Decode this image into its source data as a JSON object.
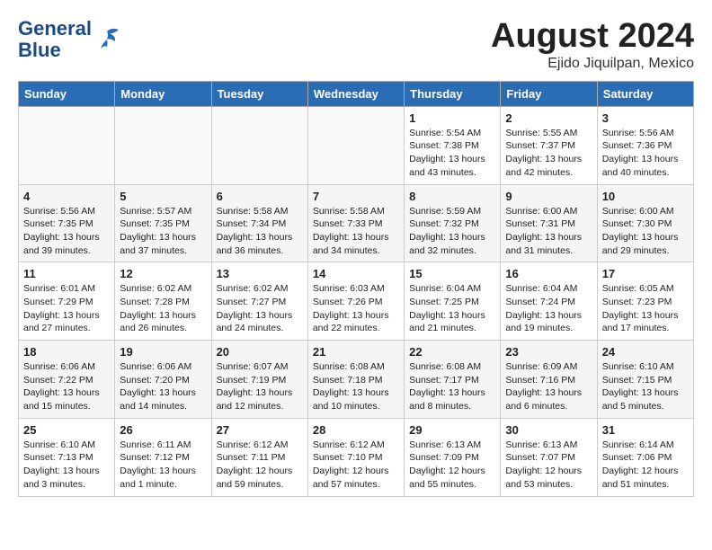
{
  "header": {
    "logo_line1": "General",
    "logo_line2": "Blue",
    "month_year": "August 2024",
    "location": "Ejido Jiquilpan, Mexico"
  },
  "weekdays": [
    "Sunday",
    "Monday",
    "Tuesday",
    "Wednesday",
    "Thursday",
    "Friday",
    "Saturday"
  ],
  "weeks": [
    [
      {
        "day": "",
        "detail": ""
      },
      {
        "day": "",
        "detail": ""
      },
      {
        "day": "",
        "detail": ""
      },
      {
        "day": "",
        "detail": ""
      },
      {
        "day": "1",
        "detail": "Sunrise: 5:54 AM\nSunset: 7:38 PM\nDaylight: 13 hours\nand 43 minutes."
      },
      {
        "day": "2",
        "detail": "Sunrise: 5:55 AM\nSunset: 7:37 PM\nDaylight: 13 hours\nand 42 minutes."
      },
      {
        "day": "3",
        "detail": "Sunrise: 5:56 AM\nSunset: 7:36 PM\nDaylight: 13 hours\nand 40 minutes."
      }
    ],
    [
      {
        "day": "4",
        "detail": "Sunrise: 5:56 AM\nSunset: 7:35 PM\nDaylight: 13 hours\nand 39 minutes."
      },
      {
        "day": "5",
        "detail": "Sunrise: 5:57 AM\nSunset: 7:35 PM\nDaylight: 13 hours\nand 37 minutes."
      },
      {
        "day": "6",
        "detail": "Sunrise: 5:58 AM\nSunset: 7:34 PM\nDaylight: 13 hours\nand 36 minutes."
      },
      {
        "day": "7",
        "detail": "Sunrise: 5:58 AM\nSunset: 7:33 PM\nDaylight: 13 hours\nand 34 minutes."
      },
      {
        "day": "8",
        "detail": "Sunrise: 5:59 AM\nSunset: 7:32 PM\nDaylight: 13 hours\nand 32 minutes."
      },
      {
        "day": "9",
        "detail": "Sunrise: 6:00 AM\nSunset: 7:31 PM\nDaylight: 13 hours\nand 31 minutes."
      },
      {
        "day": "10",
        "detail": "Sunrise: 6:00 AM\nSunset: 7:30 PM\nDaylight: 13 hours\nand 29 minutes."
      }
    ],
    [
      {
        "day": "11",
        "detail": "Sunrise: 6:01 AM\nSunset: 7:29 PM\nDaylight: 13 hours\nand 27 minutes."
      },
      {
        "day": "12",
        "detail": "Sunrise: 6:02 AM\nSunset: 7:28 PM\nDaylight: 13 hours\nand 26 minutes."
      },
      {
        "day": "13",
        "detail": "Sunrise: 6:02 AM\nSunset: 7:27 PM\nDaylight: 13 hours\nand 24 minutes."
      },
      {
        "day": "14",
        "detail": "Sunrise: 6:03 AM\nSunset: 7:26 PM\nDaylight: 13 hours\nand 22 minutes."
      },
      {
        "day": "15",
        "detail": "Sunrise: 6:04 AM\nSunset: 7:25 PM\nDaylight: 13 hours\nand 21 minutes."
      },
      {
        "day": "16",
        "detail": "Sunrise: 6:04 AM\nSunset: 7:24 PM\nDaylight: 13 hours\nand 19 minutes."
      },
      {
        "day": "17",
        "detail": "Sunrise: 6:05 AM\nSunset: 7:23 PM\nDaylight: 13 hours\nand 17 minutes."
      }
    ],
    [
      {
        "day": "18",
        "detail": "Sunrise: 6:06 AM\nSunset: 7:22 PM\nDaylight: 13 hours\nand 15 minutes."
      },
      {
        "day": "19",
        "detail": "Sunrise: 6:06 AM\nSunset: 7:20 PM\nDaylight: 13 hours\nand 14 minutes."
      },
      {
        "day": "20",
        "detail": "Sunrise: 6:07 AM\nSunset: 7:19 PM\nDaylight: 13 hours\nand 12 minutes."
      },
      {
        "day": "21",
        "detail": "Sunrise: 6:08 AM\nSunset: 7:18 PM\nDaylight: 13 hours\nand 10 minutes."
      },
      {
        "day": "22",
        "detail": "Sunrise: 6:08 AM\nSunset: 7:17 PM\nDaylight: 13 hours\nand 8 minutes."
      },
      {
        "day": "23",
        "detail": "Sunrise: 6:09 AM\nSunset: 7:16 PM\nDaylight: 13 hours\nand 6 minutes."
      },
      {
        "day": "24",
        "detail": "Sunrise: 6:10 AM\nSunset: 7:15 PM\nDaylight: 13 hours\nand 5 minutes."
      }
    ],
    [
      {
        "day": "25",
        "detail": "Sunrise: 6:10 AM\nSunset: 7:13 PM\nDaylight: 13 hours\nand 3 minutes."
      },
      {
        "day": "26",
        "detail": "Sunrise: 6:11 AM\nSunset: 7:12 PM\nDaylight: 13 hours\nand 1 minute."
      },
      {
        "day": "27",
        "detail": "Sunrise: 6:12 AM\nSunset: 7:11 PM\nDaylight: 12 hours\nand 59 minutes."
      },
      {
        "day": "28",
        "detail": "Sunrise: 6:12 AM\nSunset: 7:10 PM\nDaylight: 12 hours\nand 57 minutes."
      },
      {
        "day": "29",
        "detail": "Sunrise: 6:13 AM\nSunset: 7:09 PM\nDaylight: 12 hours\nand 55 minutes."
      },
      {
        "day": "30",
        "detail": "Sunrise: 6:13 AM\nSunset: 7:07 PM\nDaylight: 12 hours\nand 53 minutes."
      },
      {
        "day": "31",
        "detail": "Sunrise: 6:14 AM\nSunset: 7:06 PM\nDaylight: 12 hours\nand 51 minutes."
      }
    ]
  ]
}
